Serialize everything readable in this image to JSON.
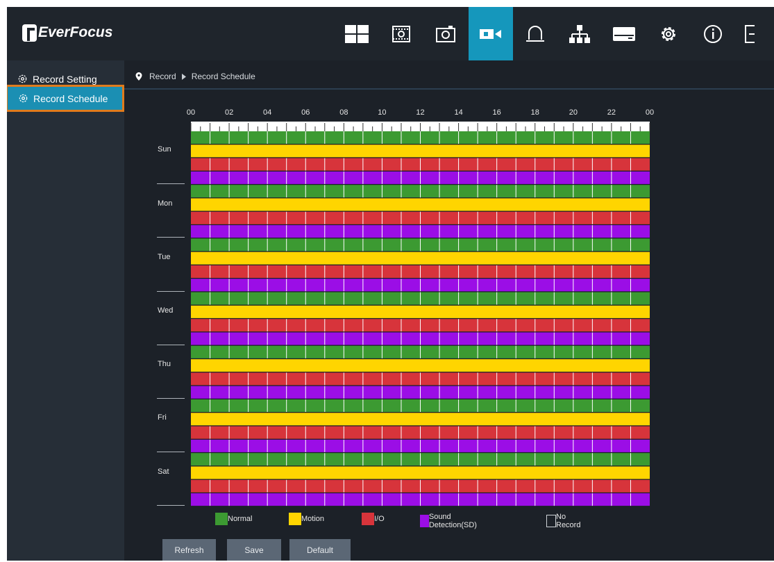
{
  "app": {
    "brand": "EverFocus"
  },
  "nav": [
    {
      "name": "live-view-icon",
      "active": false
    },
    {
      "name": "playback-icon",
      "active": false
    },
    {
      "name": "snapshot-icon",
      "active": false
    },
    {
      "name": "record-icon",
      "active": true
    },
    {
      "name": "alarm-icon",
      "active": false
    },
    {
      "name": "network-icon",
      "active": false
    },
    {
      "name": "storage-icon",
      "active": false
    },
    {
      "name": "settings-icon",
      "active": false
    },
    {
      "name": "info-icon",
      "active": false
    },
    {
      "name": "logout-icon",
      "active": false
    }
  ],
  "sidebar": {
    "items": [
      {
        "label": "Record Setting",
        "active": false
      },
      {
        "label": "Record Schedule",
        "active": true
      }
    ]
  },
  "breadcrumb": {
    "root": "Record",
    "current": "Record Schedule"
  },
  "schedule": {
    "hour_labels": [
      "00",
      "02",
      "04",
      "06",
      "08",
      "10",
      "12",
      "14",
      "16",
      "18",
      "20",
      "22",
      "00"
    ],
    "days": [
      "Sun",
      "Mon",
      "Tue",
      "Wed",
      "Thu",
      "Fri",
      "Sat"
    ],
    "rows_per_day": [
      "Normal",
      "Motion",
      "I/O",
      "Sound Detection(SD)"
    ],
    "slots_per_row": 24,
    "fill": "all-hours-enabled"
  },
  "legend": [
    {
      "label": "Normal",
      "color": "#3c9a32"
    },
    {
      "label": "Motion",
      "color": "#ffd500"
    },
    {
      "label": "I/O",
      "color": "#d7343b"
    },
    {
      "label": "Sound Detection(SD)",
      "color": "#9b0ee6"
    },
    {
      "label": "No Record",
      "color": "#1c2128"
    }
  ],
  "buttons": {
    "refresh": "Refresh",
    "save": "Save",
    "default": "Default"
  },
  "colors": {
    "accent": "#1597bc",
    "highlight": "#e07b1c"
  }
}
